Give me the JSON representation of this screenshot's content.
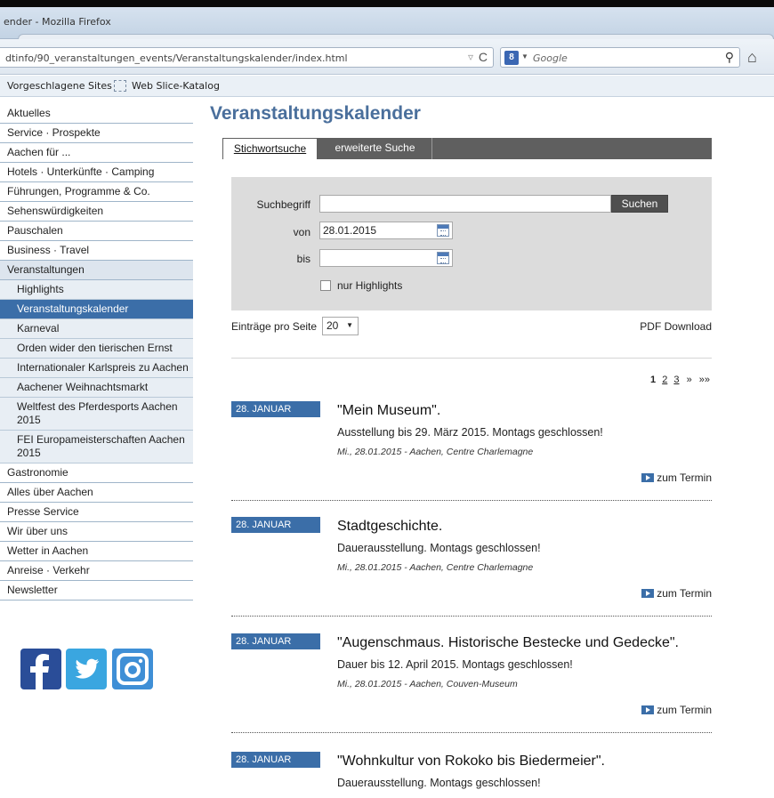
{
  "browser": {
    "title": "ender - Mozilla Firefox",
    "url": "dtinfo/90_veranstaltungen_events/Veranstaltungskalender/index.html",
    "search_placeholder": "Google",
    "search_engine_letter": "8",
    "bookmarks": [
      "Vorgeschlagene Sites",
      "Web Slice-Katalog"
    ]
  },
  "sidebar": {
    "items_top": [
      "Aktuelles",
      "Service · Prospekte",
      "Aachen für ...",
      "Hotels · Unterkünfte · Camping",
      "Führungen, Programme & Co.",
      "Sehenswürdigkeiten",
      "Pauschalen",
      "Business · Travel"
    ],
    "active_section": "Veranstaltungen",
    "sub_items": [
      "Highlights",
      "Veranstaltungskalender",
      "Karneval",
      "Orden wider den tierischen Ernst",
      "Internationaler Karlspreis zu Aachen",
      "Aachener Weihnachtsmarkt",
      "Weltfest des Pferdesports Aachen 2015",
      "FEI Europameisterschaften Aachen 2015"
    ],
    "items_bottom": [
      "Gastronomie",
      "Alles über Aachen",
      "Presse Service",
      "Wir über uns",
      "Wetter in Aachen",
      "Anreise · Verkehr",
      "Newsletter"
    ]
  },
  "main": {
    "title": "Veranstaltungskalender",
    "tabs": [
      "Stichwortsuche",
      "erweiterte Suche"
    ],
    "search": {
      "label_term": "Suchbegriff",
      "term_value": "",
      "button": "Suchen",
      "label_from": "von",
      "from_value": "28.01.2015",
      "label_to": "bis",
      "to_value": "",
      "highlights_label": "nur Highlights"
    },
    "per_page_label": "Einträge pro Seite",
    "per_page_value": "20",
    "pdf_download": "PDF Download",
    "pager": {
      "current": "1",
      "pages": [
        "2",
        "3"
      ],
      "next": "»",
      "last": "»»"
    },
    "events": [
      {
        "date": "28. JANUAR",
        "title": "\"Mein Museum\".",
        "desc": "Ausstellung bis 29. März 2015. Montags geschlossen!",
        "meta": "Mi., 28.01.2015 - Aachen, Centre Charlemagne",
        "link": "zum Termin"
      },
      {
        "date": "28. JANUAR",
        "title": "Stadtgeschichte.",
        "desc": "Dauerausstellung. Montags geschlossen!",
        "meta": "Mi., 28.01.2015 - Aachen, Centre Charlemagne",
        "link": "zum Termin"
      },
      {
        "date": "28. JANUAR",
        "title": "\"Augenschmaus. Historische Bestecke und Gedecke\".",
        "desc": "Dauer bis 12. April 2015. Montags geschlossen!",
        "meta": "Mi., 28.01.2015 - Aachen, Couven-Museum",
        "link": "zum Termin"
      },
      {
        "date": "28. JANUAR",
        "title": "\"Wohnkultur von Rokoko bis Biedermeier\".",
        "desc": "Dauerausstellung. Montags geschlossen!",
        "meta": "",
        "link": ""
      }
    ]
  },
  "colors": {
    "accent": "#3b6ea8",
    "title": "#4a6f9c",
    "tabbar": "#5f5f5f",
    "searchbox": "#dcdcdc"
  }
}
